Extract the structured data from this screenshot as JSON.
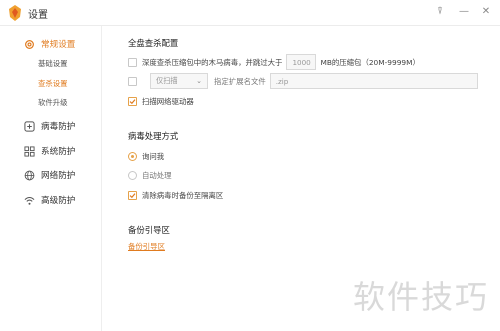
{
  "window": {
    "title": "设置"
  },
  "sidebar": {
    "groups": [
      {
        "label": "常规设置",
        "icon": "gear-icon",
        "active": true,
        "subitems": [
          {
            "label": "基础设置",
            "active": false
          },
          {
            "label": "查杀设置",
            "active": true
          },
          {
            "label": "软件升级",
            "active": false
          }
        ]
      },
      {
        "label": "病毒防护",
        "icon": "shield-plus-icon"
      },
      {
        "label": "系统防护",
        "icon": "grid-icon"
      },
      {
        "label": "网络防护",
        "icon": "globe-icon"
      },
      {
        "label": "高级防护",
        "icon": "wifi-icon"
      }
    ]
  },
  "main": {
    "full_scan": {
      "title": "全盘查杀配置",
      "skip_archive_before": "深度查杀压缩包中的木马病毒，并跳过大于",
      "archive_size_value": "1000",
      "skip_archive_after": "MB的压缩包（20M-9999M）",
      "skip_select_value": "仅扫描",
      "skip_ext_label": "指定扩展名文件",
      "skip_ext_placeholder": ".zip",
      "scan_network_label": "扫描网络驱动器"
    },
    "virus_handling": {
      "title": "病毒处理方式",
      "options": [
        "询问我",
        "自动处理"
      ],
      "backup_label": "清除病毒时备份至隔离区"
    },
    "boot": {
      "title": "备份引导区",
      "link": "备份引导区"
    }
  },
  "watermark": "软件技巧",
  "colors": {
    "accent": "#e07b1f"
  }
}
